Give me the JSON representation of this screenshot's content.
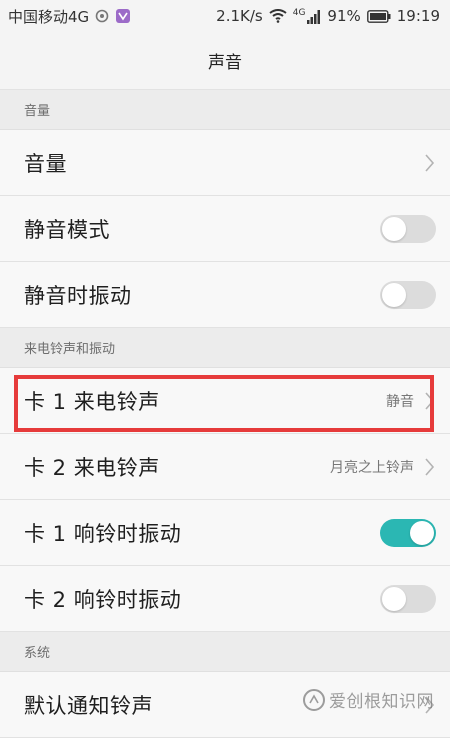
{
  "status_bar": {
    "carrier": "中国移动4G",
    "speed": "2.1K/s",
    "signal_type": "4G",
    "battery": "91%",
    "time": "19:19"
  },
  "title": "声音",
  "sections": [
    {
      "header": "音量",
      "rows": [
        {
          "title": "音量",
          "type": "chevron",
          "value": ""
        },
        {
          "title": "静音模式",
          "type": "switch",
          "on": false
        },
        {
          "title": "静音时振动",
          "type": "switch",
          "on": false
        }
      ]
    },
    {
      "header": "来电铃声和振动",
      "rows": [
        {
          "title": "卡 1 来电铃声",
          "type": "chevron",
          "value": "静音"
        },
        {
          "title": "卡 2 来电铃声",
          "type": "chevron",
          "value": "月亮之上铃声"
        },
        {
          "title": "卡 1 响铃时振动",
          "type": "switch",
          "on": true
        },
        {
          "title": "卡 2 响铃时振动",
          "type": "switch",
          "on": false
        }
      ]
    },
    {
      "header": "系统",
      "rows": [
        {
          "title": "默认通知铃声",
          "type": "chevron",
          "value": ""
        }
      ]
    }
  ],
  "watermark": {
    "text": "爱创根知识网"
  },
  "colors": {
    "accent": "#2bb7b3",
    "highlight": "#e63b3b"
  }
}
